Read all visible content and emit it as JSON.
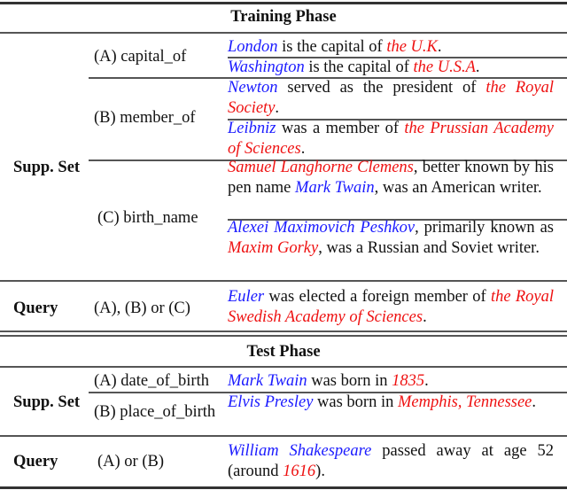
{
  "colors": {
    "head_entity": "#1a1aff",
    "tail_entity": "#ee1111"
  },
  "training": {
    "title": "Training Phase",
    "supp_label": "Supp. Set",
    "query_label": "Query",
    "relations": [
      {
        "label": "(A) capital_of",
        "examples": [
          {
            "parts": [
              {
                "t": "London",
                "c": "blue"
              },
              {
                "t": " is the capital of ",
                "c": ""
              },
              {
                "t": "the U.K",
                "c": "red"
              },
              {
                "t": ".",
                "c": ""
              }
            ]
          },
          {
            "parts": [
              {
                "t": "Washington",
                "c": "blue"
              },
              {
                "t": " is the capital of ",
                "c": ""
              },
              {
                "t": "the U.S.A",
                "c": "red"
              },
              {
                "t": ".",
                "c": ""
              }
            ]
          }
        ]
      },
      {
        "label": "(B) member_of",
        "examples": [
          {
            "parts": [
              {
                "t": "Newton",
                "c": "blue"
              },
              {
                "t": " served as the president of ",
                "c": ""
              },
              {
                "t": "the Royal Society",
                "c": "red"
              },
              {
                "t": ".",
                "c": ""
              }
            ]
          },
          {
            "parts": [
              {
                "t": "Leibniz",
                "c": "blue"
              },
              {
                "t": " was a member of ",
                "c": ""
              },
              {
                "t": "the Prussian Academy of Sciences",
                "c": "red"
              },
              {
                "t": ".",
                "c": ""
              }
            ]
          }
        ]
      },
      {
        "label": "(C) birth_name",
        "examples": [
          {
            "parts": [
              {
                "t": "Samuel Langhorne Clemens",
                "c": "red"
              },
              {
                "t": ", better known by his pen name ",
                "c": ""
              },
              {
                "t": "Mark Twain",
                "c": "blue"
              },
              {
                "t": ", was an American writer.",
                "c": ""
              }
            ]
          },
          {
            "parts": [
              {
                "t": "Alexei Maximovich Peshkov",
                "c": "blue"
              },
              {
                "t": ", primarily known as ",
                "c": ""
              },
              {
                "t": "Maxim Gorky",
                "c": "red"
              },
              {
                "t": ", was a Russian and Soviet writer.",
                "c": ""
              }
            ]
          }
        ]
      }
    ],
    "query": {
      "relation": "(A), (B) or (C)",
      "parts": [
        {
          "t": "Euler",
          "c": "blue"
        },
        {
          "t": " was elected a foreign member of ",
          "c": ""
        },
        {
          "t": "the Royal Swedish Academy of Sciences",
          "c": "red"
        },
        {
          "t": ".",
          "c": ""
        }
      ]
    }
  },
  "test": {
    "title": "Test Phase",
    "supp_label": "Supp. Set",
    "query_label": "Query",
    "relations": [
      {
        "label": "(A) date_of_birth",
        "parts": [
          {
            "t": "Mark Twain",
            "c": "blue"
          },
          {
            "t": " was born in ",
            "c": ""
          },
          {
            "t": "1835",
            "c": "red"
          },
          {
            "t": ".",
            "c": ""
          }
        ]
      },
      {
        "label": "(B) place_of_birth",
        "parts": [
          {
            "t": "Elvis Presley",
            "c": "blue"
          },
          {
            "t": " was born in ",
            "c": ""
          },
          {
            "t": "Memphis, Tennessee",
            "c": "red"
          },
          {
            "t": ".",
            "c": ""
          }
        ]
      }
    ],
    "query": {
      "relation": "(A) or (B)",
      "parts": [
        {
          "t": "William Shakespeare",
          "c": "blue"
        },
        {
          "t": " passed away at age 52 (around ",
          "c": ""
        },
        {
          "t": "1616",
          "c": "red"
        },
        {
          "t": ").",
          "c": ""
        }
      ]
    }
  }
}
